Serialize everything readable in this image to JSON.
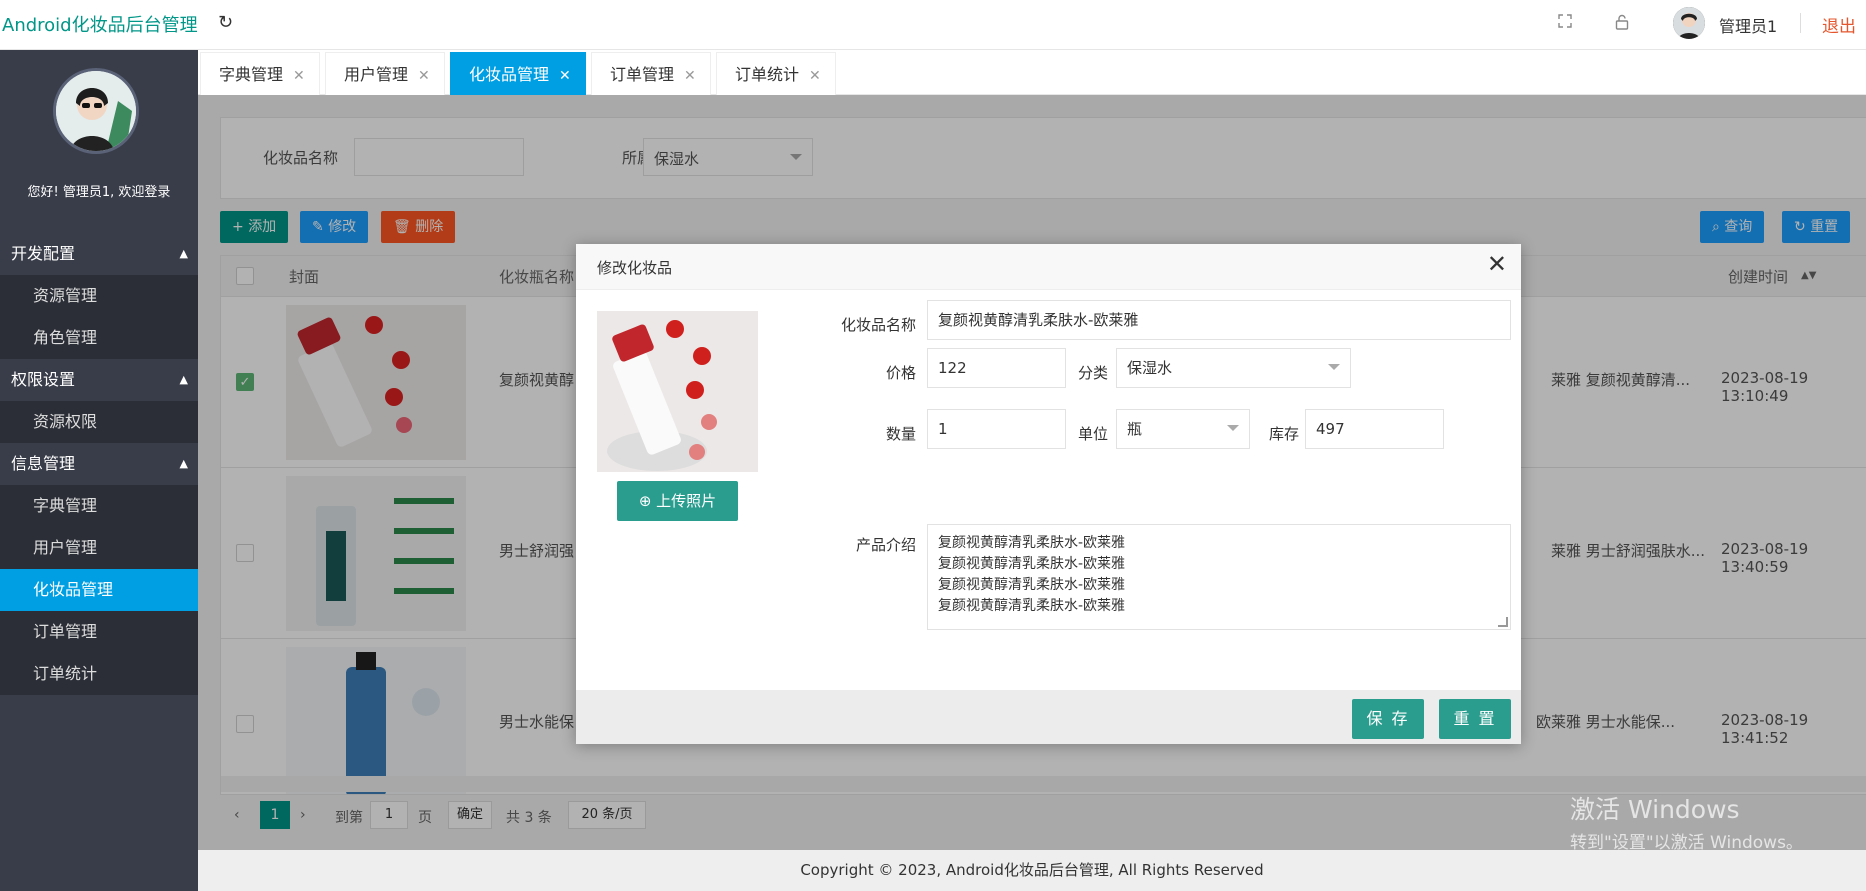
{
  "header": {
    "brand": "Android化妆品后台管理",
    "user_name": "管理员1",
    "logout": "退出"
  },
  "sidebar": {
    "welcome": "您好!  管理员1, 欢迎登录",
    "groups": [
      {
        "title": "开发配置",
        "items": [
          "资源管理",
          "角色管理"
        ]
      },
      {
        "title": "权限设置",
        "items": [
          "资源权限"
        ]
      },
      {
        "title": "信息管理",
        "items": [
          "字典管理",
          "用户管理",
          "化妆品管理",
          "订单管理",
          "订单统计"
        ]
      }
    ],
    "active_item": "化妆品管理"
  },
  "tabs": [
    "字典管理",
    "用户管理",
    "化妆品管理",
    "订单管理",
    "订单统计"
  ],
  "active_tab": "化妆品管理",
  "search": {
    "name_label": "化妆品名称",
    "category_label": "所属分类",
    "category_value": "保湿水"
  },
  "toolbar": {
    "add": "添加",
    "edit": "修改",
    "delete": "删除",
    "query": "查询",
    "reset": "重置"
  },
  "table": {
    "headers": {
      "cover": "封面",
      "name": "化妆瓶名称",
      "created": "创建时间"
    },
    "rows": [
      {
        "name": "复颜视黄醇",
        "desc": "莱雅 复颜视黄醇清...",
        "created": "2023-08-19 13:10:49",
        "checked": true
      },
      {
        "name": "男士舒润强",
        "desc": "莱雅 男士舒润强肤水...",
        "created": "2023-08-19 13:40:59",
        "checked": false
      },
      {
        "name": "男士水能保",
        "desc": "欧莱雅 男士水能保...",
        "created": "2023-08-19 13:41:52",
        "checked": false
      }
    ]
  },
  "pager": {
    "current": "1",
    "goto": "到第",
    "page_input": "1",
    "page_unit": "页",
    "confirm": "确定",
    "total": "共 3 条",
    "per_page": "20 条/页"
  },
  "footer": "Copyright © 2023, Android化妆品后台管理, All Rights Reserved",
  "watermark": {
    "line1": "激活 Windows",
    "line2": "转到\"设置\"以激活 Windows。"
  },
  "modal": {
    "title": "修改化妆品",
    "upload": "上传照片",
    "name_label": "化妆品名称",
    "name_value": "复颜视黄醇清乳柔肤水-欧莱雅",
    "price_label": "价格",
    "price_value": "122",
    "category_label": "分类",
    "category_value": "保湿水",
    "qty_label": "数量",
    "qty_value": "1",
    "unit_label": "单位",
    "unit_value": "瓶",
    "stock_label": "库存",
    "stock_value": "497",
    "intro_label": "产品介绍",
    "intro_lines": [
      "复颜视黄醇清乳柔肤水-欧莱雅",
      "复颜视黄醇清乳柔肤水-欧莱雅",
      "复颜视黄醇清乳柔肤水-欧莱雅",
      "复颜视黄醇清乳柔肤水-欧莱雅"
    ],
    "save": "保 存",
    "reset": "重 置"
  },
  "colors": {
    "brand": "#009688",
    "active_blue": "#009fe3",
    "sidebar": "#393d49",
    "logout": "#e4572e"
  }
}
